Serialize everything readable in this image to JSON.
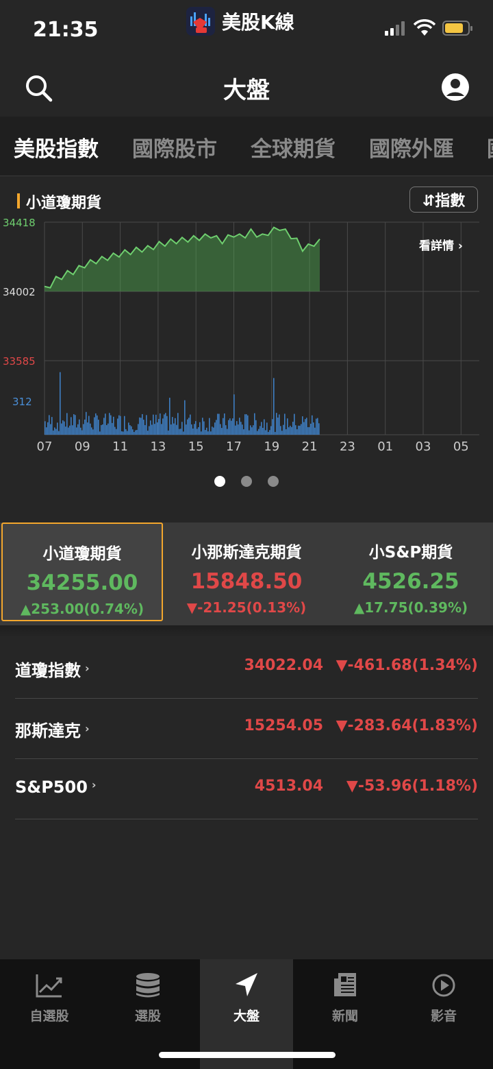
{
  "status_bar": {
    "time": "21:35",
    "app_name": "美股K線"
  },
  "nav": {
    "title": "大盤"
  },
  "tabs": [
    "美股指數",
    "國際股市",
    "全球期貨",
    "國際外匯",
    "國"
  ],
  "chart": {
    "title": "小道瓊期貨",
    "index_button": "⇵指數",
    "details_link": "看詳情",
    "price_labels": {
      "high": "34418",
      "mid": "34002",
      "low": "33585"
    },
    "volume_label": "312",
    "x_ticks": [
      "07",
      "09",
      "11",
      "13",
      "15",
      "17",
      "19",
      "21",
      "23",
      "01",
      "03",
      "05"
    ],
    "colors": {
      "line": "#6fcf6f",
      "volume": "#3f7fc4",
      "grid": "#4a4a4a"
    }
  },
  "chart_data": {
    "type": "area",
    "title": "小道瓊期貨",
    "xlabel": "",
    "ylabel": "",
    "ylim": [
      33585,
      34418
    ],
    "x_ticks": [
      "07",
      "09",
      "11",
      "13",
      "15",
      "17",
      "19",
      "21",
      "23",
      "01",
      "03",
      "05"
    ],
    "series": [
      {
        "values": [
          34015,
          34040,
          34075,
          34090,
          34110,
          34120,
          34140,
          34160,
          34175,
          34185,
          34195,
          34205,
          34215,
          34225,
          34235,
          34240,
          34250,
          34255,
          34260,
          34270,
          34285,
          34290,
          34300,
          34305,
          34310,
          34315,
          34320,
          34325,
          34330,
          34340,
          34320,
          34305,
          34325,
          34345,
          34330,
          34340,
          34360,
          34345,
          34330,
          34355,
          34370,
          34385,
          34360,
          34335,
          34305,
          34260,
          34270,
          34290,
          34300
        ]
      }
    ],
    "volume": {
      "label": "312"
    }
  },
  "pager": {
    "count": 3,
    "active": 0
  },
  "futures": [
    {
      "name": "小道瓊期貨",
      "price": "34255.00",
      "change": "▲253.00(0.74%)",
      "dir": "up"
    },
    {
      "name": "小那斯達克期貨",
      "price": "15848.50",
      "change": "▼-21.25(0.13%)",
      "dir": "down"
    },
    {
      "name": "小S&P期貨",
      "price": "4526.25",
      "change": "▲17.75(0.39%)",
      "dir": "up"
    }
  ],
  "indices": [
    {
      "name": "道瓊指數",
      "price": "34022.04",
      "change": "▼-461.68(1.34%)"
    },
    {
      "name": "那斯達克",
      "price": "15254.05",
      "change": "▼-283.64(1.83%)"
    },
    {
      "name": "S&P500",
      "price": "4513.04",
      "change": "▼-53.96(1.18%)"
    }
  ],
  "bottom_nav": [
    {
      "label": "自選股",
      "icon": "trend-chart-icon"
    },
    {
      "label": "選股",
      "icon": "database-icon"
    },
    {
      "label": "大盤",
      "icon": "navigation-arrow-icon"
    },
    {
      "label": "新聞",
      "icon": "newspaper-icon"
    },
    {
      "label": "影音",
      "icon": "play-circle-icon"
    }
  ],
  "bottom_nav_active": 2
}
